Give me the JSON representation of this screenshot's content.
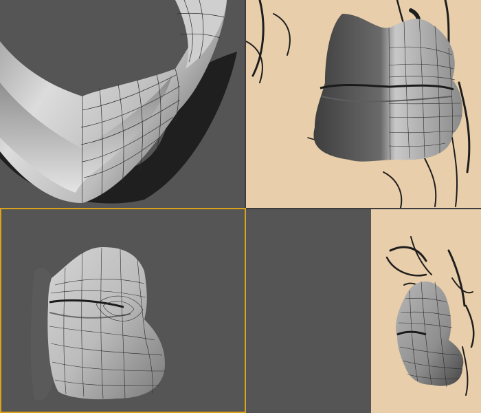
{
  "viewports": [
    {
      "id": "top-left",
      "content": "mouth-mesh-bottom-view",
      "active": false
    },
    {
      "id": "top-right",
      "content": "mouth-mesh-front-over-sketch",
      "active": false
    },
    {
      "id": "bottom-left",
      "content": "mouth-mesh-perspective",
      "active": true
    },
    {
      "id": "bottom-right",
      "content": "mouth-mesh-side-over-sketch",
      "active": false
    }
  ],
  "colors": {
    "viewport_background": "#555555",
    "reference_paper": "#e8ceaa",
    "sketch_ink": "#1e1e1e",
    "mesh_light": "#d6d6d6",
    "mesh_dark": "#3a3a3a",
    "wire": "#2a2a2a",
    "active_border": "#d9a21b",
    "splitter": "#3c3c3c"
  }
}
